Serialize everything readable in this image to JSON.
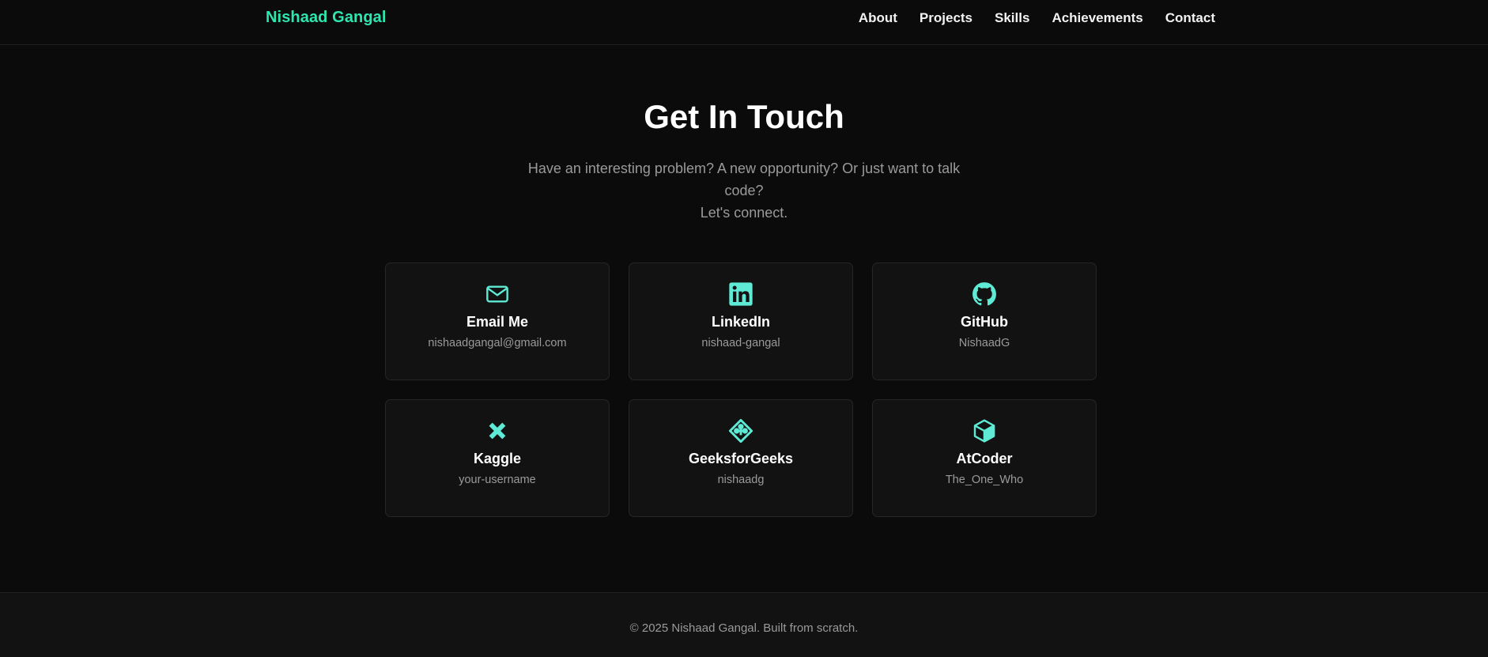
{
  "brand": {
    "name": "Nishaad Gangal",
    "color": "#2ee6b0"
  },
  "nav": {
    "items": [
      {
        "label": "About"
      },
      {
        "label": "Projects"
      },
      {
        "label": "Skills"
      },
      {
        "label": "Achievements"
      },
      {
        "label": "Contact"
      }
    ]
  },
  "contact": {
    "title": "Get In Touch",
    "subtitle_line1": "Have an interesting problem? A new opportunity? Or just want to talk code?",
    "subtitle_line2": "Let's connect.",
    "cards": [
      {
        "icon": "mail-icon",
        "title": "Email Me",
        "handle": "nishaadgangal@gmail.com"
      },
      {
        "icon": "linkedin-icon",
        "title": "LinkedIn",
        "handle": "nishaad-gangal"
      },
      {
        "icon": "github-icon",
        "title": "GitHub",
        "handle": "NishaadG"
      },
      {
        "icon": "kaggle-icon",
        "title": "Kaggle",
        "handle": "your-username"
      },
      {
        "icon": "geeksforgeeks-icon",
        "title": "GeeksforGeeks",
        "handle": "nishaadg"
      },
      {
        "icon": "atcoder-cube-icon",
        "title": "AtCoder",
        "handle": "The_One_Who"
      }
    ]
  },
  "footer": {
    "text": "© 2025 Nishaad Gangal. Built from scratch."
  },
  "colors": {
    "background": "#0b0b0b",
    "card": "#121212",
    "accent": "#5eead4",
    "muted": "#9a9a9a"
  }
}
